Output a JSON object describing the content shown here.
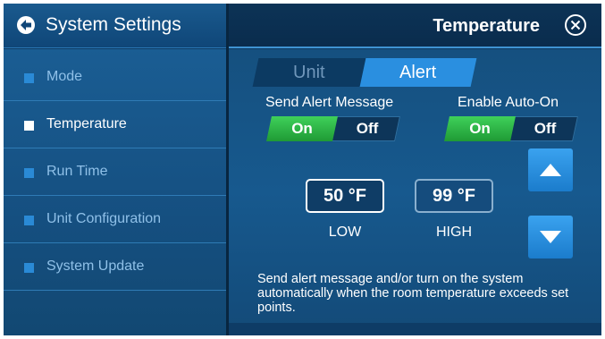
{
  "header": {
    "title": "System Settings",
    "page_title": "Temperature"
  },
  "sidebar": {
    "items": [
      {
        "label": "Mode"
      },
      {
        "label": "Temperature"
      },
      {
        "label": "Run Time"
      },
      {
        "label": "Unit Configuration"
      },
      {
        "label": "System Update"
      }
    ]
  },
  "tabs": {
    "unit": "Unit",
    "alert": "Alert"
  },
  "alert_message": {
    "label": "Send Alert Message",
    "on": "On",
    "off": "Off"
  },
  "auto_on": {
    "label": "Enable Auto-On",
    "on": "On",
    "off": "Off"
  },
  "low": {
    "value": "50 °F",
    "caption": "LOW"
  },
  "high": {
    "value": "99 °F",
    "caption": "HIGH"
  },
  "description": "Send alert message and/or turn on the system automatically when the room temperature exceeds set points.",
  "colors": {
    "accent": "#2a8fe0",
    "toggle_on": "#2fbf4a",
    "background": "#0d3a63"
  }
}
